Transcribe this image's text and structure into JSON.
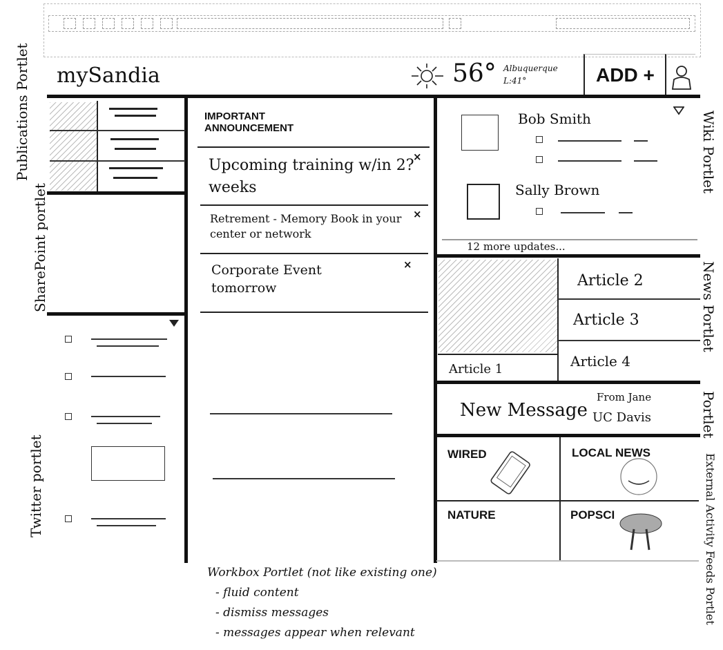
{
  "header": {
    "app_title": "mySandia",
    "weather_temp": "56°",
    "weather_city": "Albuquerque",
    "weather_low": "L:41°",
    "add_label": "ADD +"
  },
  "icons": [
    "sun-icon",
    "user-icon",
    "dropdown-triangle-icon"
  ],
  "side_labels": {
    "publications": "Publications Portlet",
    "sharepoint": "SharePoint portlet",
    "twitter": "Twitter portlet",
    "wiki": "Wiki Portlet",
    "news": "News Portlet",
    "message": "Portlet",
    "external": "External Activity Feeds Portlet"
  },
  "workbox": {
    "heading": "IMPORTANT ANNOUNCEMENT",
    "messages": [
      {
        "text": "Upcoming training w/in 2? weeks"
      },
      {
        "text": "Retrement - Memory Book in your center or network"
      },
      {
        "text": "Corporate Event tomorrow"
      }
    ],
    "dismiss_label": "×"
  },
  "wiki": {
    "people": [
      {
        "name": "Bob Smith"
      },
      {
        "name": "Sally Brown"
      }
    ],
    "more_updates": "12 more updates..."
  },
  "articles": {
    "a1": "Article 1",
    "a2": "Article 2",
    "a3": "Article 3",
    "a4": "Article 4"
  },
  "message": {
    "title": "New Message",
    "from": "From Jane",
    "org": "UC Davis"
  },
  "feeds": {
    "wired": "WIRED",
    "local_news": "LOCAL NEWS",
    "nature": "NATURE",
    "popsci": "POPSCI"
  },
  "notes": {
    "title": "Workbox Portlet (not like existing one)",
    "bullets": [
      "- fluid content",
      "- dismiss messages",
      "- messages appear when relevant"
    ]
  }
}
